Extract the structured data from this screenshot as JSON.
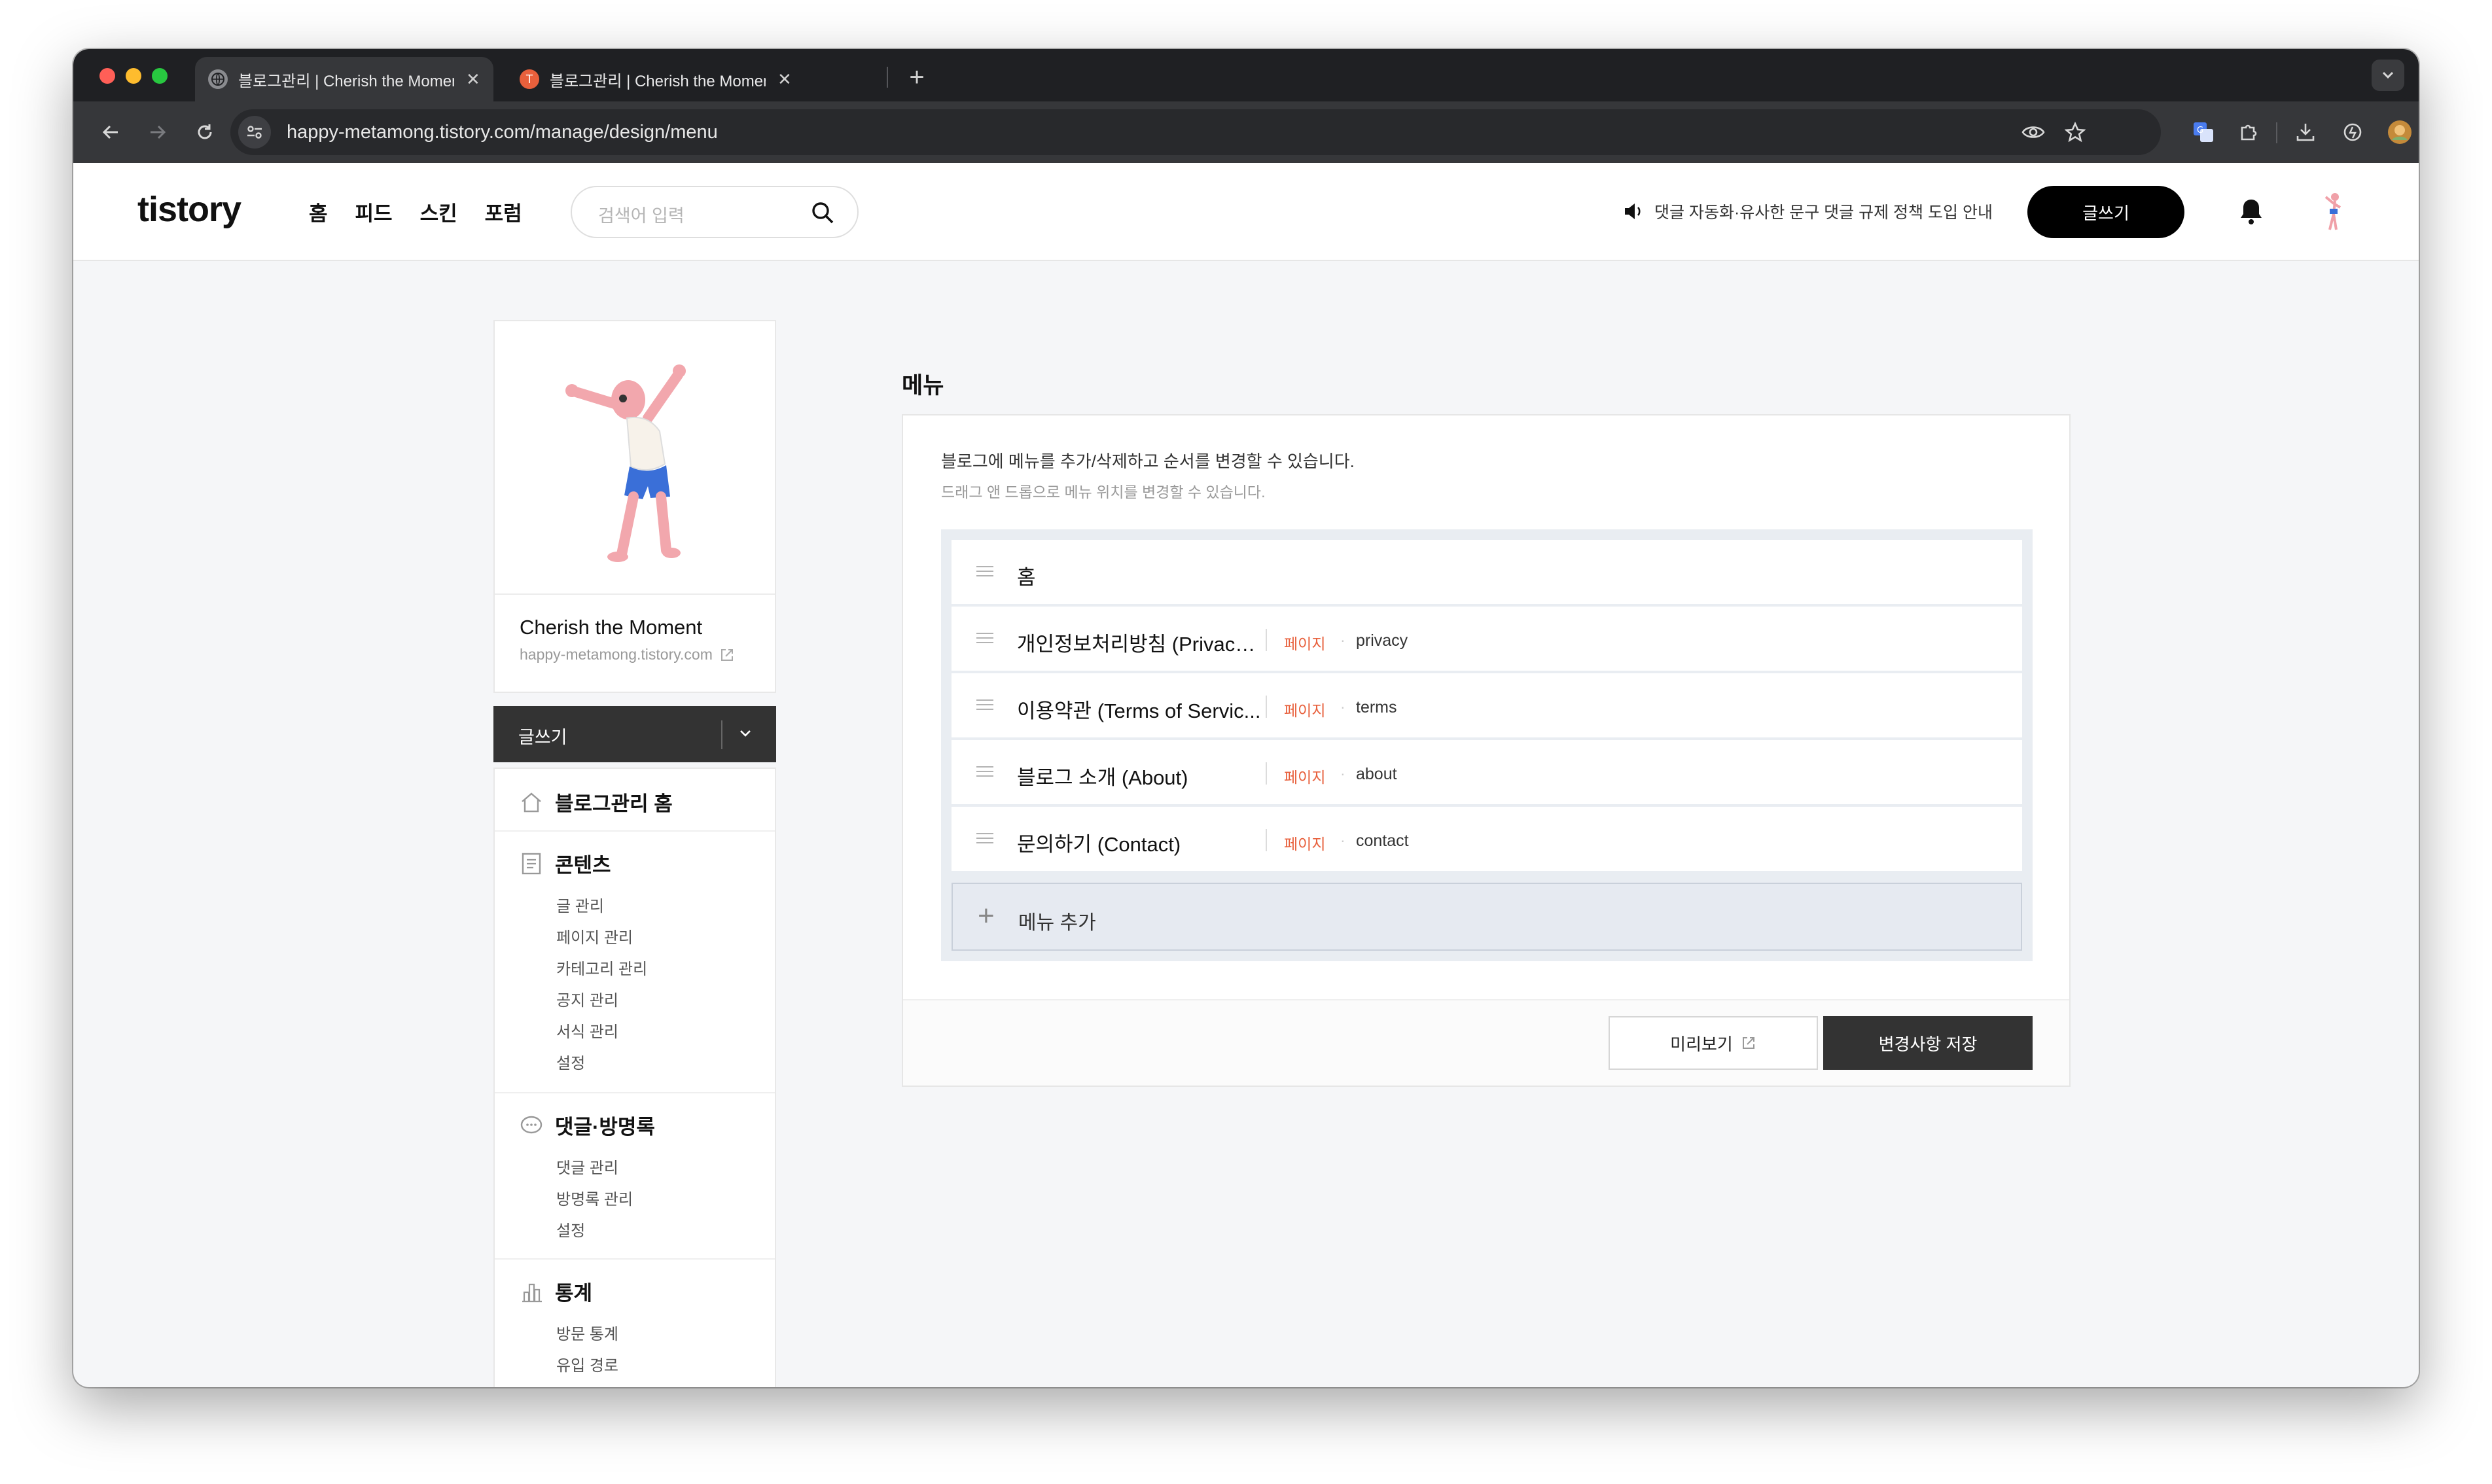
{
  "browser": {
    "tabs": [
      {
        "title": "블로그관리 | Cherish the Moment",
        "active": true
      },
      {
        "title": "블로그관리 | Cherish the Moment",
        "active": false
      }
    ],
    "url": "happy-metamong.tistory.com/manage/design/menu"
  },
  "header": {
    "logo": "tistory",
    "nav": [
      "홈",
      "피드",
      "스킨",
      "포럼"
    ],
    "search_placeholder": "검색어 입력",
    "notice": "댓글 자동화·유사한 문구 댓글 규제 정책 도입 안내",
    "write_label": "글쓰기"
  },
  "sidebar": {
    "blog_name": "Cherish the Moment",
    "blog_url": "happy-metamong.tistory.com",
    "write_label": "글쓰기",
    "home_label": "블로그관리 홈",
    "groups": [
      {
        "title": "콘텐츠",
        "icon": "document-icon",
        "items": [
          "글 관리",
          "페이지 관리",
          "카테고리 관리",
          "공지 관리",
          "서식 관리",
          "설정"
        ]
      },
      {
        "title": "댓글·방명록",
        "icon": "comment-icon",
        "items": [
          "댓글 관리",
          "방명록 관리",
          "설정"
        ]
      },
      {
        "title": "통계",
        "icon": "chart-icon",
        "items": [
          "방문 통계",
          "유입 경로"
        ]
      }
    ]
  },
  "main": {
    "title": "메뉴",
    "desc1": "블로그에 메뉴를 추가/삭제하고 순서를 변경할 수 있습니다.",
    "desc2": "드래그 앤 드롭으로 메뉴 위치를 변경할 수 있습니다.",
    "menu_items": [
      {
        "name": "홈",
        "type": "",
        "slug": ""
      },
      {
        "name": "개인정보처리방침 (Privacy ...",
        "type": "페이지",
        "slug": "privacy"
      },
      {
        "name": "이용약관 (Terms of Servic...",
        "type": "페이지",
        "slug": "terms"
      },
      {
        "name": "블로그 소개 (About)",
        "type": "페이지",
        "slug": "about"
      },
      {
        "name": "문의하기 (Contact)",
        "type": "페이지",
        "slug": "contact"
      }
    ],
    "add_label": "메뉴 추가",
    "preview_label": "미리보기",
    "save_label": "변경사항 저장"
  },
  "colors": {
    "accent": "#e8603c",
    "dark_button": "#333333"
  }
}
